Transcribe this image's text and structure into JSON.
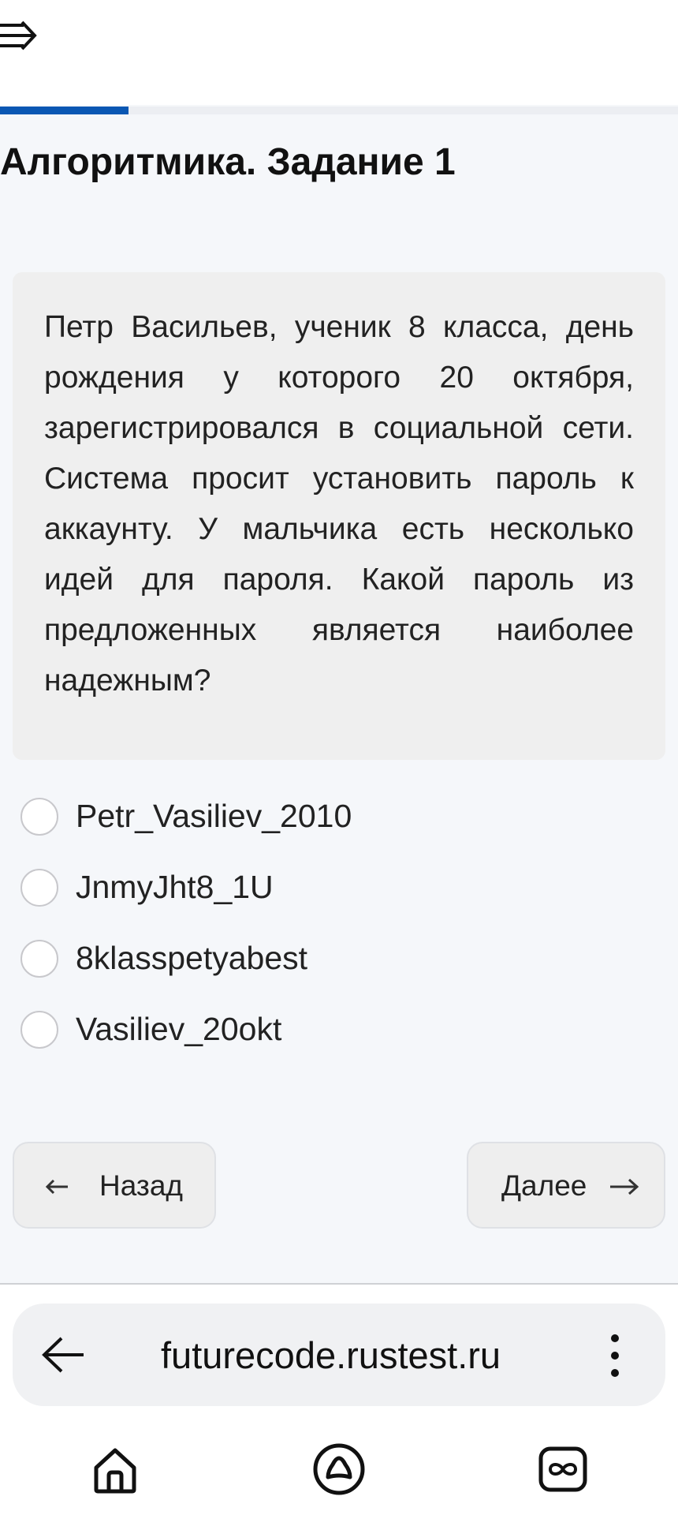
{
  "header": {
    "menu_icon": "collapse-menu-icon"
  },
  "progress": {
    "fraction": 0.19,
    "color": "#0a57b3"
  },
  "page_title": "Алгоритмика. Задание 1",
  "question": {
    "text": "Петр Васильев, ученик 8 класса, день рождения у которого 20 октября, зарегистрировался в социальной сети. Система просит установить пароль к аккаунту. У мальчика есть несколько идей для пароля. Какой пароль из предложенных является наиболее надежным?"
  },
  "options": [
    {
      "label": "Petr_Vasiliev_2010",
      "selected": false
    },
    {
      "label": "JnmyJht8_1U",
      "selected": false
    },
    {
      "label": "8klasspetyabest",
      "selected": false
    },
    {
      "label": "Vasiliev_20okt",
      "selected": false
    }
  ],
  "navigation": {
    "back_label": "Назад",
    "next_label": "Далее"
  },
  "browser": {
    "url": "futurecode.rustest.ru",
    "back_icon": "arrow-left-icon",
    "menu_icon": "more-vertical-icon"
  },
  "system_nav": [
    "home-icon",
    "assistant-icon",
    "tabs-icon"
  ]
}
